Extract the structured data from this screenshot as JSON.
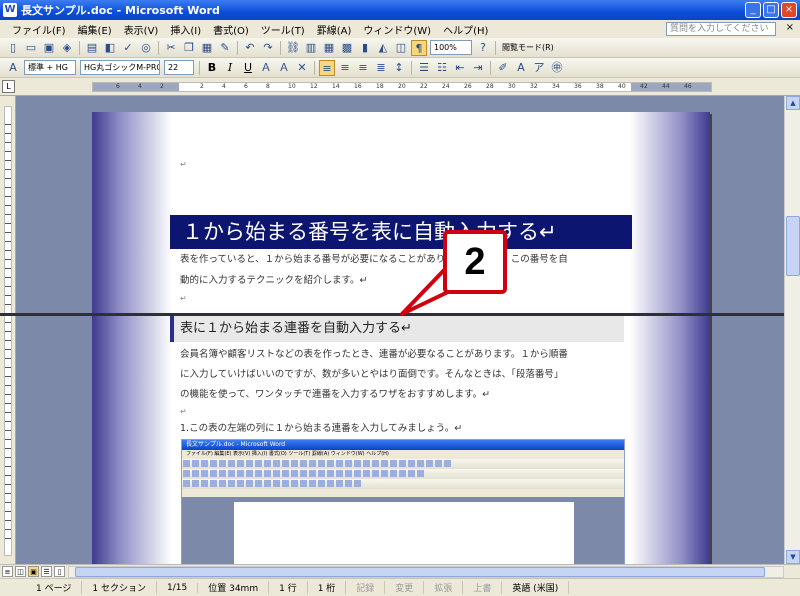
{
  "window": {
    "title": "長文サンプル.doc - Microsoft Word",
    "app_icon": "W",
    "minimize": "_",
    "maximize": "□",
    "close": "×"
  },
  "menu": {
    "items": [
      "ファイル(F)",
      "編集(E)",
      "表示(V)",
      "挿入(I)",
      "書式(O)",
      "ツール(T)",
      "罫線(A)",
      "ウィンドウ(W)",
      "ヘルプ(H)"
    ],
    "help_placeholder": "質問を入力してください",
    "doc_close": "×"
  },
  "toolbar_standard": {
    "zoom": "100%",
    "reading_mode": "閲覧モード(R)"
  },
  "toolbar_format": {
    "style": "標準 + HG",
    "font": "HG丸ゴシックM-PRO",
    "size": "22",
    "bold": "B",
    "italic": "I",
    "underline": "U",
    "font_color": "A"
  },
  "ruler": {
    "corner": "L",
    "ticks": [
      "6",
      "4",
      "2",
      "2",
      "4",
      "6",
      "8",
      "10",
      "12",
      "14",
      "16",
      "18",
      "20",
      "22",
      "24",
      "26",
      "28",
      "30",
      "32",
      "34",
      "36",
      "38",
      "40",
      "42",
      "44",
      "46"
    ]
  },
  "document": {
    "para_mark": "↵",
    "heading1": "１から始まる番号を表に自動入力する↵",
    "intro_line1": "表を作っていると、１から始まる番号が必要になることがあります。今回は、この番号を自",
    "intro_line2": "動的に入力するテクニックを紹介します。↵",
    "heading2": "表に１から始まる連番を自動入力する↵",
    "body_line1": "会員名簿や顧客リストなどの表を作ったとき、連番が必要なることがあります。１から順番",
    "body_line2": "に入力していけばいいのですが、数が多いとやはり面倒です。そんなときは、「段落番号」",
    "body_line3": "の機能を使って、ワンタッチで連番を入力するワザをおすすめします。↵",
    "step1": "1.この表の左端の列に１から始まる連番を入力してみましょう。↵"
  },
  "callout": {
    "number": "2"
  },
  "embedded_screenshot": {
    "title": "長文サンプル.doc - Microsoft Word",
    "menu": "ファイル(F)  編集(E)  表示(V)  挿入(I)  書式(O)  ツール(T)  罫線(A)  ウィンドウ(W)  ヘルプ(H)"
  },
  "statusbar": {
    "page": "1 ページ",
    "section": "1 セクション",
    "page_count": "1/15",
    "position": "位置 34mm",
    "line": "1 行",
    "column": "1 桁",
    "rec": "記録",
    "trk": "変更",
    "ext": "拡張",
    "ovr": "上書",
    "language": "英語 (米国)"
  },
  "colors": {
    "heading_bg": "#0c1670",
    "callout_border": "#d0000e",
    "title_bar": "#0a4fd8"
  }
}
